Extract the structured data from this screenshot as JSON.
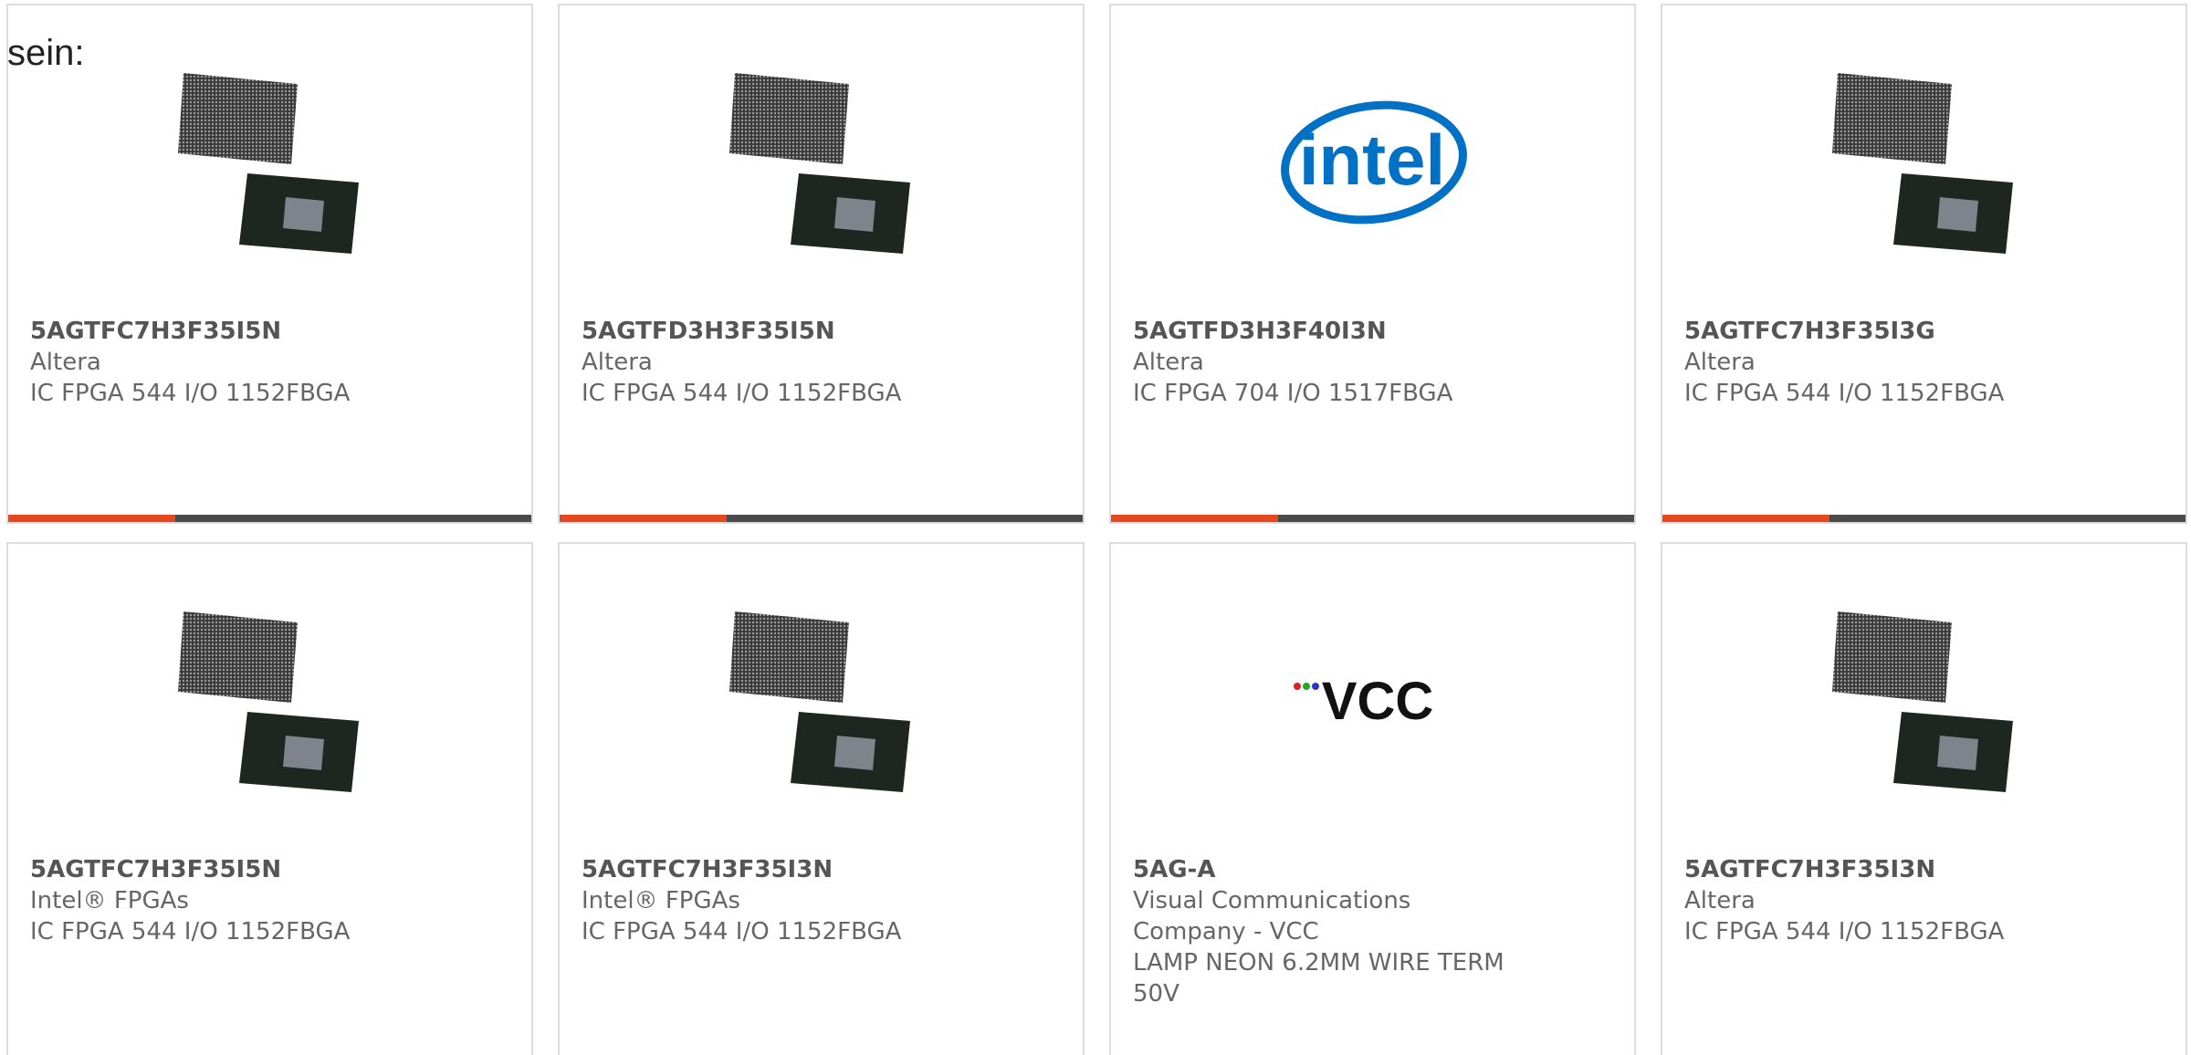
{
  "intro_text": "sein:",
  "colors": {
    "accent": "#e8461c",
    "bar": "#4a4a4a",
    "border": "#dcdcdc",
    "text": "#666666",
    "intel_blue": "#0071c5"
  },
  "bar_progress": 0.32,
  "cards": [
    {
      "part": "5AGTFC7H3F35I5N",
      "maker": "Altera",
      "desc": "IC FPGA 544 I/O 1152FBGA",
      "image": "fpga-chip"
    },
    {
      "part": "5AGTFD3H3F35I5N",
      "maker": "Altera",
      "desc": "IC FPGA 544 I/O 1152FBGA",
      "image": "fpga-chip"
    },
    {
      "part": "5AGTFD3H3F40I3N",
      "maker": "Altera",
      "desc": "IC FPGA 704 I/O 1517FBGA",
      "image": "intel-logo",
      "logo_text": "intel"
    },
    {
      "part": "5AGTFC7H3F35I3G",
      "maker": "Altera",
      "desc": "IC FPGA 544 I/O 1152FBGA",
      "image": "fpga-chip"
    },
    {
      "part": "5AGTFC7H3F35I5N",
      "maker": "Intel® FPGAs",
      "desc": "IC FPGA 544 I/O 1152FBGA",
      "image": "fpga-chip"
    },
    {
      "part": "5AGTFC7H3F35I3N",
      "maker": "Intel® FPGAs",
      "desc": "IC FPGA 544 I/O 1152FBGA",
      "image": "fpga-chip"
    },
    {
      "part": "5AG-A",
      "maker": "Visual Communications Company - VCC",
      "desc": "LAMP NEON 6.2MM WIRE TERM 50V",
      "image": "vcc-logo",
      "logo_text": "VCC"
    },
    {
      "part": "5AGTFC7H3F35I3N",
      "maker": "Altera",
      "desc": "IC FPGA 544 I/O 1152FBGA",
      "image": "fpga-chip"
    }
  ]
}
